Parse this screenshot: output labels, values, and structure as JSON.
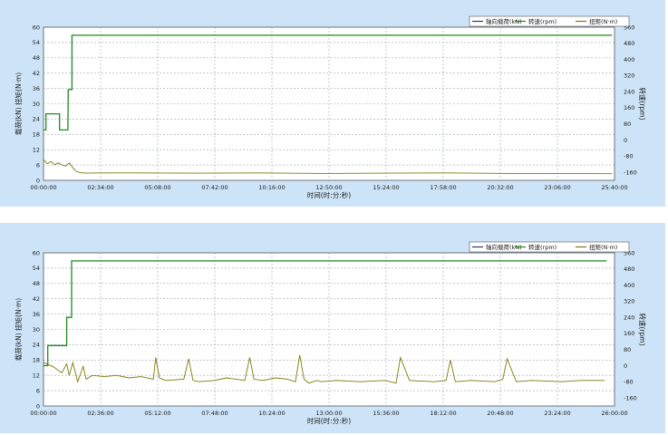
{
  "colors": {
    "background": "#cde4f8",
    "plot_background": "#ffffff",
    "grid": "#9aa4b3",
    "load_series": "#2b3a6b",
    "speed_series": "#1f8a22",
    "torque_series": "#7f7a0a"
  },
  "chart_data": [
    {
      "type": "line",
      "title": "",
      "xlabel": "时间(时:分:秒)",
      "ylabel": "载荷(kN) 扭矩(N·m)",
      "y2label": "转速(rpm)",
      "x_ticks": [
        "00:00:00",
        "02:34:00",
        "05:08:00",
        "07:42:00",
        "10:16:00",
        "12:50:00",
        "15:24:00",
        "17:58:00",
        "20:32:00",
        "23:06:00",
        "25:40:00"
      ],
      "xlim_seconds": [
        0,
        92400
      ],
      "ylim": [
        0,
        60
      ],
      "y_ticks": [
        0,
        6,
        12,
        18,
        24,
        30,
        36,
        42,
        48,
        54,
        60
      ],
      "y2lim": [
        -200,
        560
      ],
      "y2_ticks": [
        -160,
        -80,
        0,
        80,
        160,
        240,
        320,
        400,
        480,
        560
      ],
      "grid": true,
      "legend_position": "top-right",
      "legend": [
        "轴向载荷(kN)",
        "转速(rpm)",
        "扭矩(N·m)"
      ],
      "series": [
        {
          "name": "转速(rpm)",
          "axis": "right",
          "x_seconds": [
            0,
            400,
            400,
            2600,
            2600,
            3950,
            4000,
            4150,
            4600,
            4600,
            92000
          ],
          "values": [
            50,
            50,
            130,
            130,
            50,
            50,
            250,
            250,
            250,
            520,
            520
          ]
        },
        {
          "name": "扭矩(N·m)",
          "axis": "left",
          "x_seconds": [
            0,
            600,
            1200,
            1800,
            2400,
            3000,
            3600,
            4200,
            4800,
            5400,
            6000,
            7000,
            9000,
            15000,
            25000,
            35000,
            45000,
            55000,
            65000,
            75000,
            85000,
            92000
          ],
          "values": [
            8.2,
            6.5,
            7.4,
            6.1,
            6.8,
            6.0,
            5.6,
            6.8,
            4.8,
            3.4,
            3.0,
            2.8,
            2.9,
            2.9,
            2.8,
            2.9,
            2.7,
            2.8,
            2.9,
            2.7,
            2.7,
            2.6
          ]
        }
      ]
    },
    {
      "type": "line",
      "title": "",
      "xlabel": "时间(时:分:秒)",
      "ylabel": "载荷(kN) 扭矩(N·m)",
      "y2label": "转速(rpm)",
      "x_ticks": [
        "00:00:00",
        "02:36:00",
        "05:12:00",
        "07:48:00",
        "10:24:00",
        "13:00:00",
        "15:36:00",
        "18:12:00",
        "20:48:00",
        "23:24:00",
        "26:00:00"
      ],
      "xlim_seconds": [
        0,
        93600
      ],
      "ylim": [
        0,
        60
      ],
      "y_ticks": [
        0,
        6,
        12,
        18,
        24,
        30,
        36,
        42,
        48,
        54,
        60
      ],
      "y2lim": [
        -200,
        560
      ],
      "y2_ticks": [
        -160,
        -80,
        0,
        80,
        160,
        240,
        320,
        400,
        480,
        560
      ],
      "grid": true,
      "legend_position": "top-right",
      "legend": [
        "轴向载荷(kN)",
        "转速(rpm)",
        "扭矩(N·m)"
      ],
      "series": [
        {
          "name": "转速(rpm)",
          "axis": "right",
          "x_seconds": [
            0,
            700,
            700,
            3800,
            3800,
            4600,
            4600,
            92300
          ],
          "values": [
            0,
            0,
            100,
            100,
            240,
            240,
            520,
            520
          ]
        },
        {
          "name": "扭矩(N·m)",
          "axis": "left",
          "x_seconds": [
            0,
            1500,
            3000,
            3800,
            4200,
            4800,
            5600,
            6500,
            7000,
            8000,
            10000,
            12000,
            14000,
            16000,
            18000,
            18400,
            19000,
            20000,
            23000,
            23800,
            24500,
            25500,
            28000,
            30000,
            33000,
            33800,
            34500,
            36000,
            38000,
            40000,
            41300,
            42000,
            42700,
            43500,
            44800,
            45500,
            48000,
            52000,
            56000,
            57800,
            58500,
            60000,
            64000,
            66000,
            66700,
            67500,
            70000,
            74000,
            75300,
            76000,
            77500,
            80000,
            85000,
            88000,
            92000
          ],
          "values": [
            17.0,
            15.5,
            13.0,
            16.5,
            12.0,
            17.0,
            9.5,
            15.5,
            10.5,
            12.0,
            11.5,
            12.0,
            11.0,
            11.5,
            10.5,
            19.0,
            11.0,
            10.0,
            10.5,
            18.5,
            10.0,
            9.5,
            10.0,
            11.0,
            10.0,
            19.0,
            10.5,
            10.0,
            11.0,
            10.5,
            9.5,
            20.0,
            10.5,
            9.0,
            10.0,
            9.5,
            10.0,
            9.5,
            10.0,
            9.0,
            19.0,
            10.0,
            9.5,
            10.0,
            18.0,
            9.5,
            10.0,
            9.5,
            10.5,
            18.5,
            9.5,
            10.0,
            9.5,
            10.0,
            10.0
          ]
        }
      ]
    }
  ]
}
